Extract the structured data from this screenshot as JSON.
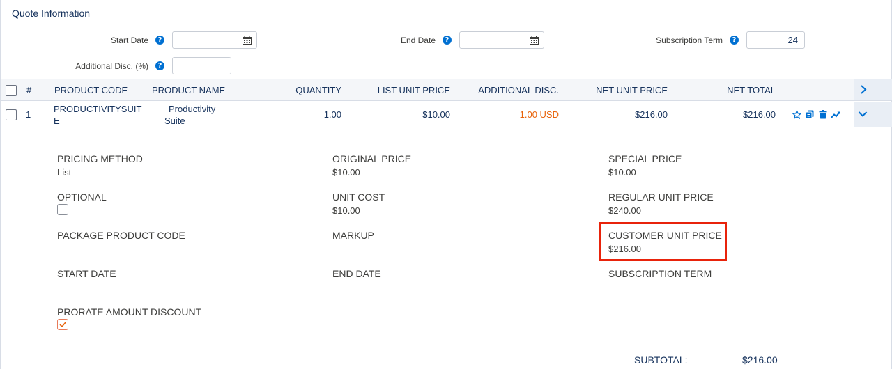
{
  "section_title": "Quote Information",
  "header_fields": {
    "start_date_label": "Start Date",
    "start_date_value": "",
    "end_date_label": "End Date",
    "end_date_value": "",
    "subscription_term_label": "Subscription Term",
    "subscription_term_value": "24",
    "additional_disc_label": "Additional Disc. (%)",
    "additional_disc_value": "",
    "help_glyph": "?"
  },
  "table": {
    "columns": {
      "number": "#",
      "product_code": "PRODUCT CODE",
      "product_name": "PRODUCT NAME",
      "quantity": "QUANTITY",
      "list_unit_price": "LIST UNIT PRICE",
      "additional_disc": "ADDITIONAL DISC.",
      "net_unit_price": "NET UNIT PRICE",
      "net_total": "NET TOTAL"
    },
    "rows": [
      {
        "number": "1",
        "product_code_line1": "PRODUCTIVITYSUIT",
        "product_code_line2": "E",
        "product_name_line1": "Productivity",
        "product_name_line2": "Suite",
        "quantity": "1.00",
        "list_unit_price": "$10.00",
        "additional_disc": "1.00 USD",
        "net_unit_price": "$216.00",
        "net_total": "$216.00"
      }
    ],
    "row_actions": [
      "star-icon",
      "clone-icon",
      "delete-icon",
      "trend-icon"
    ]
  },
  "details": {
    "pricing_method_label": "PRICING METHOD",
    "pricing_method_value": "List",
    "original_price_label": "ORIGINAL PRICE",
    "original_price_value": "$10.00",
    "special_price_label": "SPECIAL PRICE",
    "special_price_value": "$10.00",
    "optional_label": "OPTIONAL",
    "unit_cost_label": "UNIT COST",
    "unit_cost_value": "$10.00",
    "regular_unit_price_label": "REGULAR UNIT PRICE",
    "regular_unit_price_value": "$240.00",
    "package_product_code_label": "PACKAGE PRODUCT CODE",
    "markup_label": "MARKUP",
    "customer_unit_price_label": "CUSTOMER UNIT PRICE",
    "customer_unit_price_value": "$216.00",
    "start_date_label": "START DATE",
    "end_date_label": "END DATE",
    "subscription_term_label": "SUBSCRIPTION TERM",
    "prorate_amount_discount_label": "PRORATE AMOUNT DISCOUNT"
  },
  "footer": {
    "subtotal_label": "SUBTOTAL:",
    "subtotal_value": "$216.00"
  },
  "colors": {
    "accent_blue": "#0070d2",
    "discount_orange": "#e8630a",
    "highlight_red": "#e8230b"
  }
}
